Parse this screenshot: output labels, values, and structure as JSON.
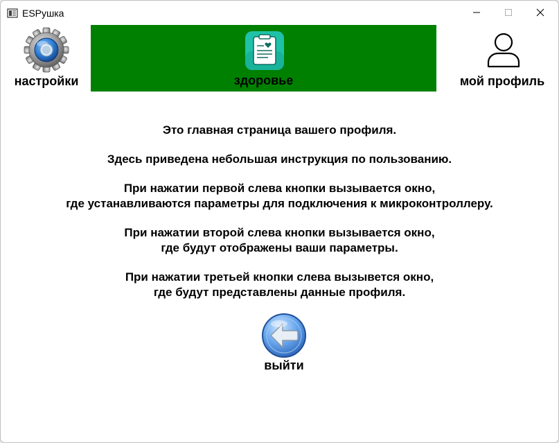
{
  "window": {
    "title": "ESPушка"
  },
  "toolbar": {
    "settings": {
      "label": "настройки",
      "icon": "gear-icon"
    },
    "health": {
      "label": "здоровье",
      "icon": "health-clipboard-icon",
      "panel_color": "#008000"
    },
    "profile": {
      "label": "мой профиль",
      "icon": "user-icon"
    }
  },
  "main": {
    "paragraphs": [
      "Это главная страница вашего профиля.",
      "Здесь приведена небольшая инструкция по пользованию.",
      "При нажатии первой слева кнопки вызывается окно,\nгде устанавливаются параметры для подключения к микроконтроллеру.",
      "При нажатии второй слева кнопки вызывается окно,\nгде будут отображены ваши параметры.",
      "При нажатии третьей кнопки слева вызывется окно,\nгде будут представлены данные профиля."
    ]
  },
  "exit": {
    "label": "выйти",
    "icon": "back-arrow-icon"
  }
}
